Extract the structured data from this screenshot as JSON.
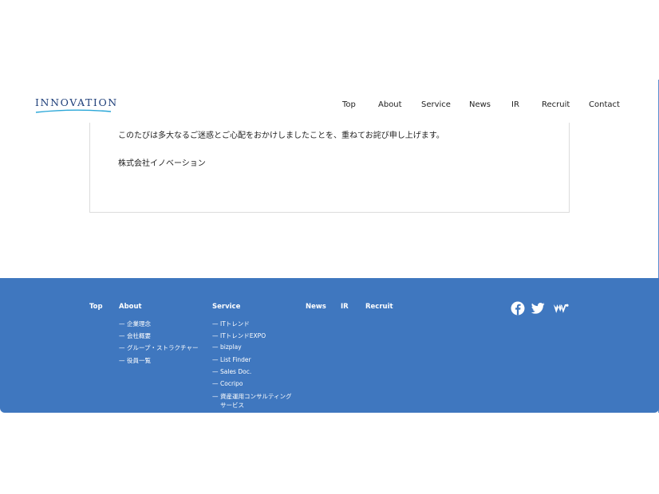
{
  "header": {
    "logo_text": "INNOVATION",
    "nav": [
      "Top",
      "About",
      "Service",
      "News",
      "IR",
      "Recruit",
      "Contact"
    ]
  },
  "content": {
    "line1": "このたびは多大なるご迷惑とご心配をおかけしましたことを、重ねてお詫び申し上げます。",
    "line2": "株式会社イノベーション"
  },
  "footer": {
    "top": "Top",
    "about": {
      "label": "About",
      "items": [
        "企業理念",
        "会社概要",
        "グループ・ストラクチャー",
        "役員一覧"
      ]
    },
    "service": {
      "label": "Service",
      "items": [
        "ITトレンド",
        "ITトレンドEXPO",
        "bizplay",
        "List Finder",
        "Sales Doc.",
        "Cocripo",
        "資産運用コンサルティング"
      ],
      "last_item_cont": "サービス"
    },
    "news": "News",
    "ir": "IR",
    "recruit": "Recruit",
    "social_icons": [
      "facebook-icon",
      "twitter-icon",
      "wantedly-icon"
    ]
  },
  "colors": {
    "footer_bg": "#3f77bf",
    "text": "#222222",
    "accent_rule": "#5a8fd0"
  }
}
